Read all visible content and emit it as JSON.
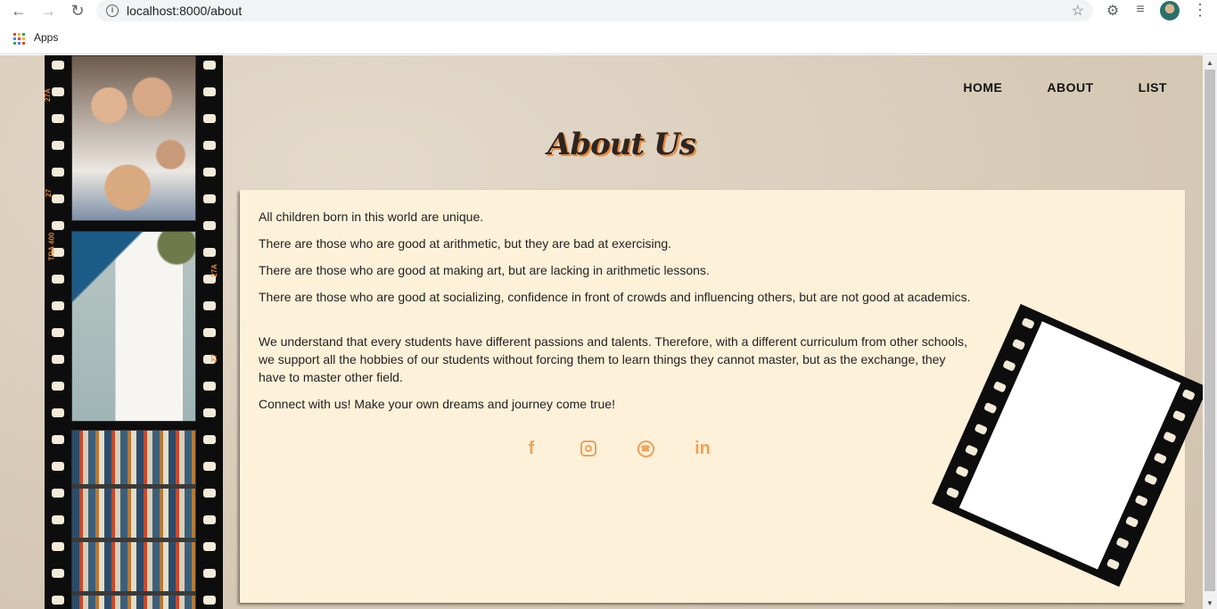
{
  "browser": {
    "url": "localhost:8000/about",
    "bookmark_apps_label": "Apps"
  },
  "nav": {
    "home": "HOME",
    "about": "ABOUT",
    "list": "LIST"
  },
  "page_title": "About Us",
  "film_labels": [
    "27A",
    "27",
    "TRA 400",
    "27A",
    "27"
  ],
  "content": {
    "p1": "All children born in this world are unique.",
    "p2": "There are those who are good at arithmetic, but they are bad at exercising.",
    "p3": "There are those who are good at making art, but are lacking in arithmetic lessons.",
    "p4": "There are those who are good at socializing, confidence in front of crowds and influencing others, but are not good at academics.",
    "p5": "We understand that every students have different passions and talents. Therefore, with a different curriculum from other schools, we support all the hobbies of our students without forcing them to learn things they cannot master, but as the exchange, they have to master other field.",
    "p6": "Connect with us! Make your own dreams and journey come true!"
  },
  "social_icons": [
    "facebook-icon",
    "instagram-icon",
    "whatsapp-icon",
    "linkedin-icon"
  ],
  "colors": {
    "accent": "#eca25a",
    "card_bg": "#fef1d9",
    "title_shadow": "#e88b3a"
  }
}
